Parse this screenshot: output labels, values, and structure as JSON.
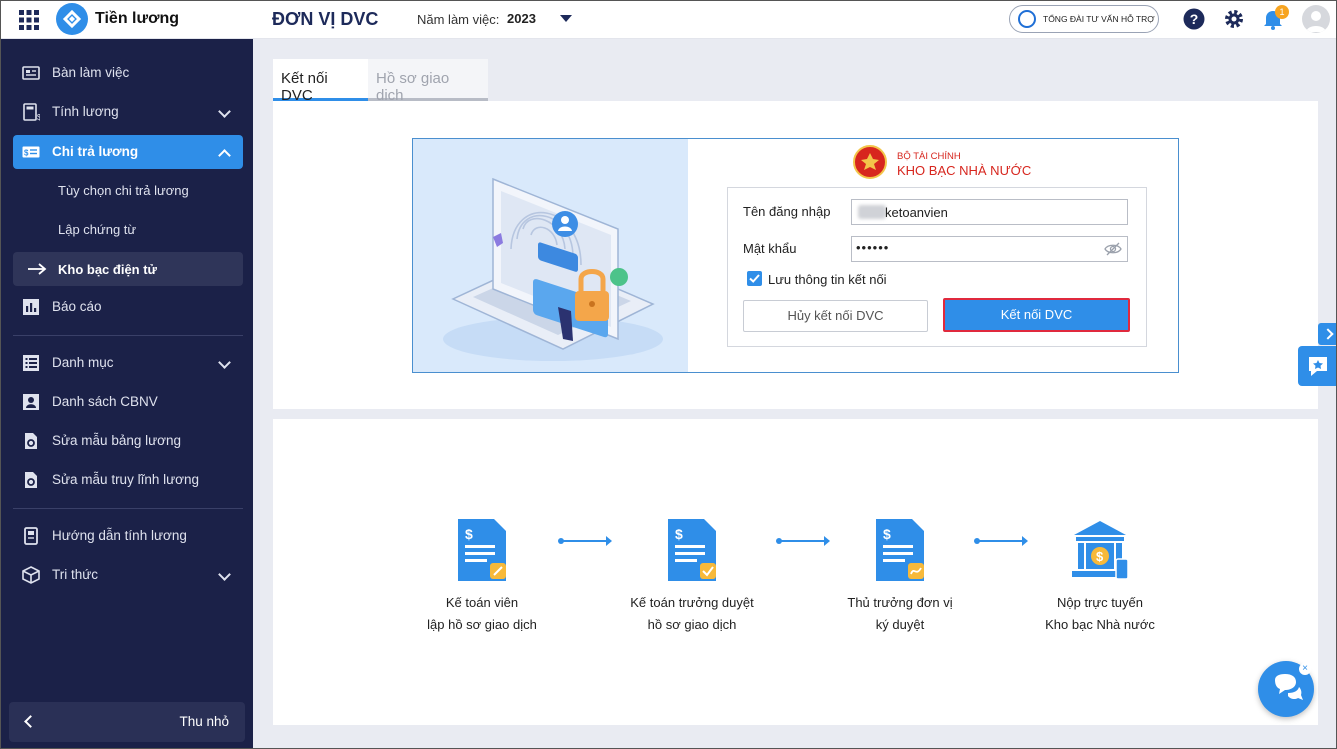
{
  "header": {
    "app_title": "Tiền lương",
    "unit_title": "ĐƠN VỊ DVC",
    "year_label": "Năm làm việc:",
    "year_value": "2023",
    "hotline": "TỔNG ĐÀI TƯ VẤN HỖ TRỢ",
    "notification_count": "1",
    "icons": [
      "apps-grid-icon",
      "app-logo",
      "phone-icon",
      "help-icon",
      "gear-icon",
      "bell-icon",
      "user-avatar"
    ]
  },
  "sidebar": {
    "items": [
      {
        "label": "Bàn làm việc",
        "icon": "desk-icon"
      },
      {
        "label": "Tính lương",
        "icon": "calculator-icon"
      },
      {
        "label": "Chi trả lương",
        "icon": "money-card-icon"
      },
      {
        "label": "Tùy chọn chi trả lương"
      },
      {
        "label": "Lập chứng từ"
      },
      {
        "label": "Kho bạc điện tử"
      },
      {
        "label": "Báo cáo",
        "icon": "report-chart-icon"
      },
      {
        "label": "Danh mục",
        "icon": "list-icon"
      },
      {
        "label": "Danh sách CBNV",
        "icon": "employee-icon"
      },
      {
        "label": "Sửa mẫu bảng lương",
        "icon": "template-gear-icon"
      },
      {
        "label": "Sửa mẫu truy lĩnh lương",
        "icon": "template-gear-icon"
      },
      {
        "label": "Hướng dẫn tính lương",
        "icon": "guide-book-icon"
      },
      {
        "label": "Tri thức",
        "icon": "cube-icon"
      }
    ],
    "collapse_label": "Thu nhỏ"
  },
  "tabs": [
    {
      "label": "Kết nối DVC",
      "active": true
    },
    {
      "label": "Hồ sơ giao dịch",
      "active": false
    }
  ],
  "connect": {
    "ministry_line1": "BỘ TÀI CHÍNH",
    "ministry_line2": "KHO BẠC NHÀ NƯỚC",
    "username_label": "Tên đăng nhập",
    "username_value": "ketoanvien",
    "password_label": "Mật khẩu",
    "password_value": "••••••",
    "remember_label": "Lưu thông tin kết nối",
    "remember_checked": true,
    "cancel_button": "Hủy kết nối DVC",
    "connect_button": "Kết nối DVC"
  },
  "flow": {
    "steps": [
      {
        "line1": "Kế toán viên",
        "line2": "lập hồ sơ giao dịch"
      },
      {
        "line1": "Kế toán trưởng duyệt",
        "line2": "hồ sơ giao dịch"
      },
      {
        "line1": "Thủ trưởng đơn vị",
        "line2": "ký duyệt"
      },
      {
        "line1": "Nộp trực tuyến",
        "line2": "Kho bạc Nhà nước"
      }
    ]
  },
  "colors": {
    "accent": "#2f8ee8",
    "sidebar_bg": "#1b2148",
    "highlight_border": "#e0293d",
    "ministry_red": "#d7261e"
  }
}
